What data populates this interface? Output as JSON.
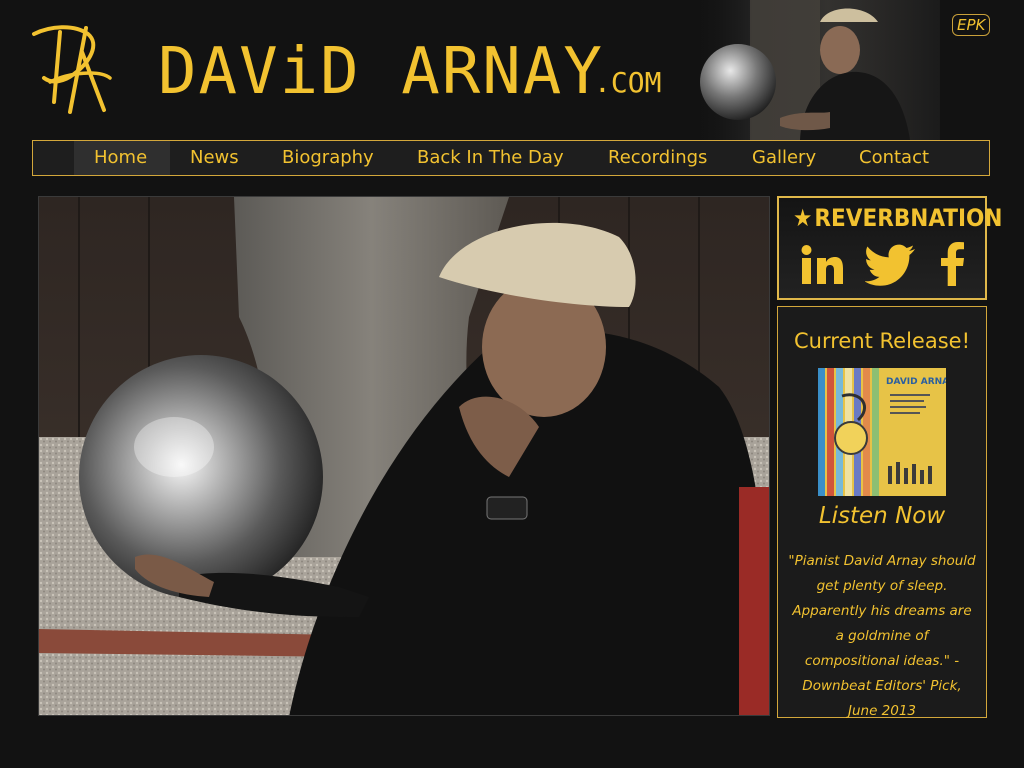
{
  "header": {
    "title": "DAViD ARNAY",
    "title_suffix": ".COM",
    "epk_label": "EPK"
  },
  "nav": {
    "items": [
      {
        "label": "Home",
        "active": true
      },
      {
        "label": "News"
      },
      {
        "label": "Biography"
      },
      {
        "label": "Back In The Day"
      },
      {
        "label": "Recordings"
      },
      {
        "label": "Gallery"
      },
      {
        "label": "Contact"
      }
    ]
  },
  "social": {
    "reverbnation_label": "REVERBNATION",
    "icons": [
      "reverbnation-icon",
      "linkedin-icon",
      "twitter-icon",
      "facebook-icon"
    ]
  },
  "release": {
    "heading": "Current Release!",
    "album_artist": "DAVID ARNAY",
    "listen_label": "Listen Now",
    "quote": "\"Pianist David Arnay should get plenty of sleep. Apparently his dreams are a goldmine of compositional ideas.\" -Downbeat Editors' Pick, June 2013"
  },
  "colors": {
    "accent": "#f2c230",
    "border": "#d3a73b",
    "background": "#121212"
  }
}
